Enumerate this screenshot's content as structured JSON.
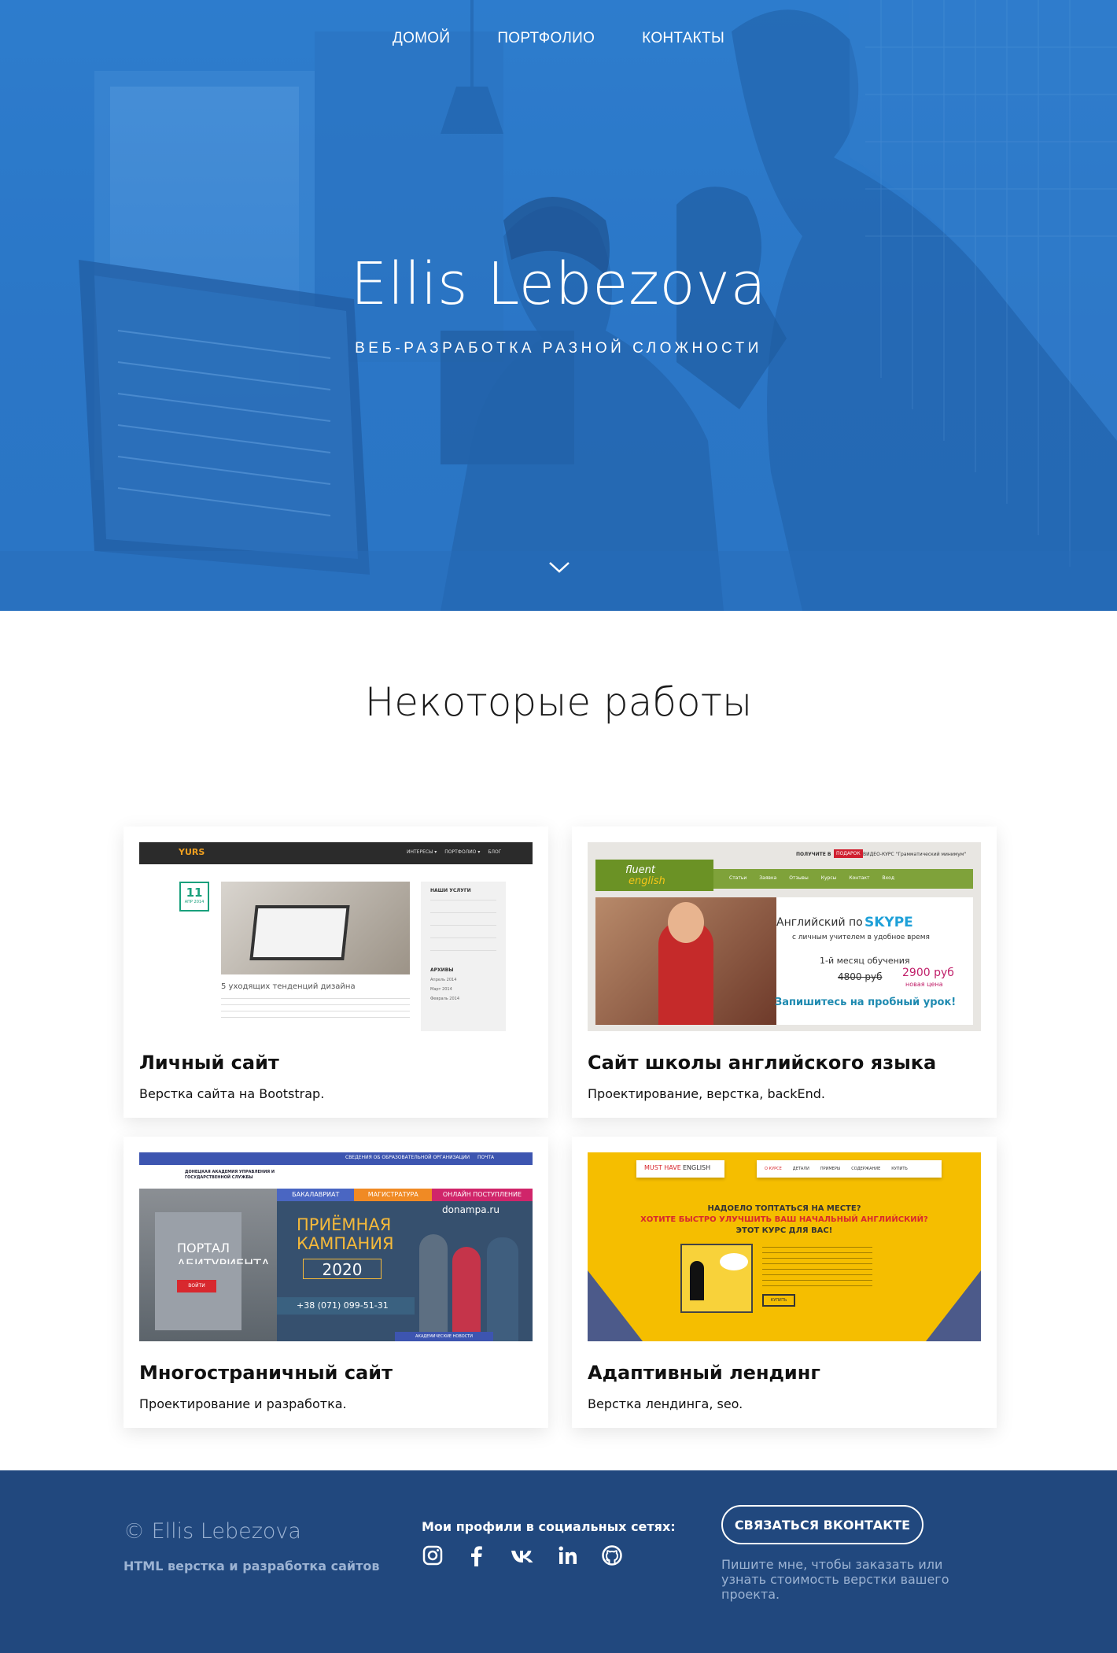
{
  "nav": {
    "home": "ДОМОЙ",
    "portfolio": "ПОРТФОЛИО",
    "contacts": "КОНТАКТЫ"
  },
  "hero": {
    "title": "Ellis Lebezova",
    "subtitle": "ВЕБ-РАЗРАБОТКА РАЗНОЙ СЛОЖНОСТИ"
  },
  "portfolio": {
    "heading": "Некоторые работы",
    "items": [
      {
        "title": "Личный сайт",
        "desc": "Верстка сайта на Bootstrap."
      },
      {
        "title": "Сайт школы английского языка",
        "desc": "Проектирование, верстка, backEnd."
      },
      {
        "title": "Многостраничный сайт",
        "desc": "Проектирование и разработка."
      },
      {
        "title": "Адаптивный лендинг",
        "desc": "Верстка лендинга, seo."
      }
    ],
    "thumb1": {
      "logo": "YURS",
      "menu": [
        "ИНТЕРЕСЫ ▾",
        "ПОРТФОЛИО ▾",
        "БЛОГ"
      ],
      "date_day": "11",
      "date_month": "АПР 2014",
      "post_title": "5 уходящих тенденций дизайна",
      "sidebar_title": "НАШИ УСЛУГИ",
      "archive_title": "АРХИВЫ",
      "archive": [
        "Апрель 2014",
        "Март 2014",
        "Февраль 2014"
      ]
    },
    "thumb2": {
      "top": "ПОЛУЧИТЕ В",
      "gift": "ПОДАРОК",
      "course": "ВИДЕО-КУРС \"Грамматический минимум\"",
      "logo1": "fluent",
      "logo2": "english",
      "menu": [
        "Статьи",
        "Заявка",
        "Отзывы",
        "Курсы",
        "Контакт",
        "Вход"
      ],
      "l1": "Английский по",
      "skype": "SKYPE",
      "l2": "с личным учителем в удобное время",
      "l3": "1-й месяц обучения",
      "old_price": "4800 руб",
      "new_price": "2900 руб",
      "new_label": "новая цена",
      "cta": "Запишитесь на пробный урок!"
    },
    "thumb3": {
      "tabs": [
        "БАКАЛАВРИАТ",
        "МАГИСТРАТУРА",
        "ОНЛАЙН ПОСТУПЛЕНИЕ"
      ],
      "portal": "ПОРТАЛ",
      "portal2": "АБИТУРИЕНТА",
      "login": "ВОЙТИ",
      "campaign1": "ПРИЁМНАЯ",
      "campaign2": "КАМПАНИЯ",
      "year": "2020",
      "site": "donampa.ru",
      "phone": "+38 (071) 099-51-31",
      "news": "АКАДЕМИЧЕСКИЕ НОВОСТИ",
      "org": "ДОНЕЦКАЯ АКАДЕМИЯ УПРАВЛЕНИЯ И ГОСУДАРСТВЕННОЙ СЛУЖБЫ",
      "topbar": "СВЕДЕНИЯ ОБ ОБРАЗОВАТЕЛЬНОЙ ОРГАНИЗАЦИИ",
      "mail": "ПОЧТА"
    },
    "thumb4": {
      "brand1": "MUST HAVE",
      "brand2": "ENGLISH",
      "menu": [
        "О КУРСЕ",
        "ДЕТАЛИ",
        "ПРИМЕРЫ",
        "СОДЕРЖАНИЕ",
        "КУПИТЬ"
      ],
      "h1": "НАДОЕЛО ТОПТАТЬСЯ НА МЕСТЕ?",
      "h2": "ХОТИТЕ БЫСТРО УЛУЧШИТЬ ВАШ НАЧАЛЬНЫЙ АНГЛИЙСКИЙ?",
      "h3": "ЭТОТ КУРС ДЛЯ ВАС!",
      "buy": "КУПИТЬ"
    }
  },
  "footer": {
    "copyright": "© Ellis Lebezova",
    "tagline": "HTML верстка и разработка сайтов",
    "social_title": "Мои профили в социальных сетях:",
    "cta": "СВЯЗАТЬСЯ ВКОНТАКТЕ",
    "note": "Пишите мне, чтобы заказать или узнать стоимость верстки вашего проекта."
  },
  "colors": {
    "hero_blue": "#2b78c8",
    "footer_bg": "#21487e",
    "footer_muted": "#9cb3d3"
  }
}
